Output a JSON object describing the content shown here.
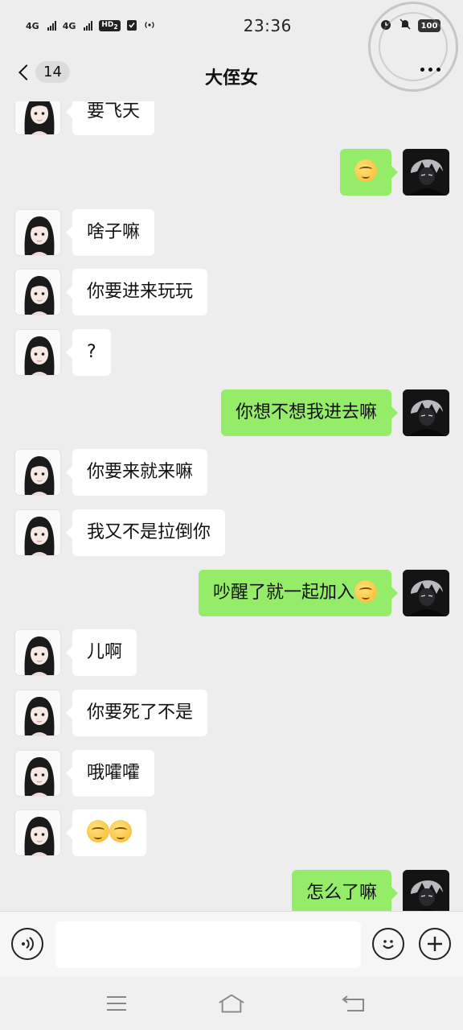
{
  "status_bar": {
    "network1": "4G",
    "network2": "4G",
    "hd": "HD",
    "hd_sub": "2",
    "time": "23:36",
    "battery": "100"
  },
  "header": {
    "unread_count": "14",
    "title": "大侄女"
  },
  "messages": [
    {
      "side": "left",
      "text": "要飞天"
    },
    {
      "side": "right",
      "emoji": [
        "blush-emoji"
      ]
    },
    {
      "side": "left",
      "text": "啥子嘛"
    },
    {
      "side": "left",
      "text": "你要进来玩玩"
    },
    {
      "side": "left",
      "text": "?"
    },
    {
      "side": "right",
      "text": "你想不想我进去嘛"
    },
    {
      "side": "left",
      "text": "你要来就来嘛"
    },
    {
      "side": "left",
      "text": "我又不是拉倒你"
    },
    {
      "side": "right",
      "text": "吵醒了就一起加入",
      "emoji": [
        "laugh-cry-emoji"
      ]
    },
    {
      "side": "left",
      "text": "儿啊"
    },
    {
      "side": "left",
      "text": "你要死了不是"
    },
    {
      "side": "left",
      "text": "哦嚯嚯"
    },
    {
      "side": "left",
      "emoji": [
        "flushed-emoji",
        "flushed-emoji"
      ]
    },
    {
      "side": "right",
      "text": "怎么了嘛"
    }
  ],
  "input": {
    "placeholder": ""
  },
  "colors": {
    "background": "#ededed",
    "sent_bubble": "#95ec69",
    "received_bubble": "#ffffff"
  }
}
